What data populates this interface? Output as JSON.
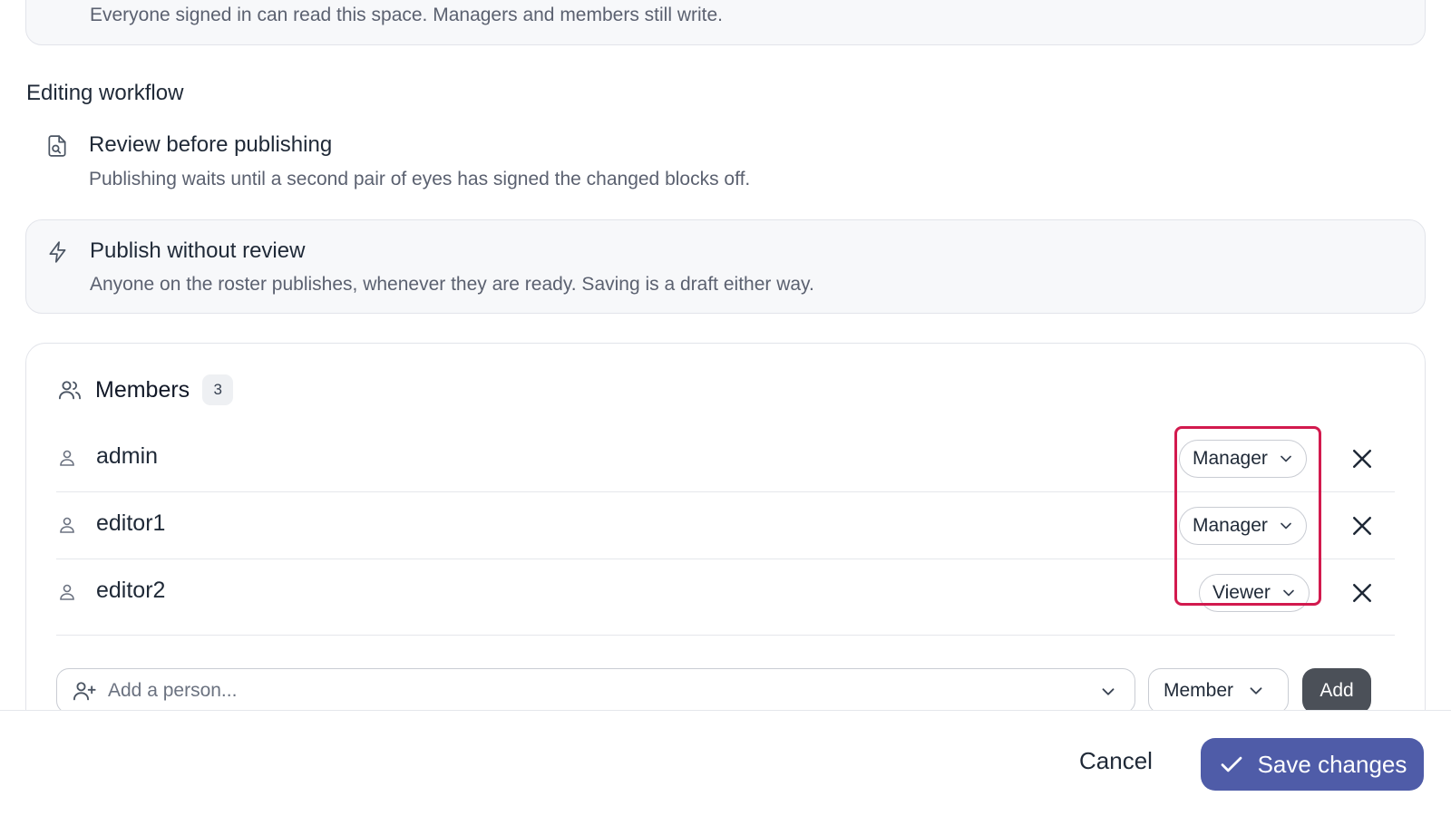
{
  "visibility": {
    "description": "Everyone signed in can read this space. Managers and members still write."
  },
  "editing_workflow": {
    "title": "Editing workflow",
    "options": [
      {
        "icon": "review-document-icon",
        "title": "Review before publishing",
        "description": "Publishing waits until a second pair of eyes has signed the changed blocks off.",
        "selected": false
      },
      {
        "icon": "lightning-icon",
        "title": "Publish without review",
        "description": "Anyone on the roster publishes, whenever they are ready. Saving is a draft either way.",
        "selected": true
      }
    ]
  },
  "members": {
    "title": "Members",
    "count": "3",
    "list": [
      {
        "name": "admin",
        "role": "Manager"
      },
      {
        "name": "editor1",
        "role": "Manager"
      },
      {
        "name": "editor2",
        "role": "Viewer"
      }
    ],
    "add": {
      "placeholder": "Add a person...",
      "role": "Member",
      "button": "Add"
    }
  },
  "footer": {
    "cancel": "Cancel",
    "save": "Save changes"
  },
  "colors": {
    "primary": "#4f5ca8",
    "highlight": "#d21a4e",
    "add_button": "#4b5058"
  }
}
